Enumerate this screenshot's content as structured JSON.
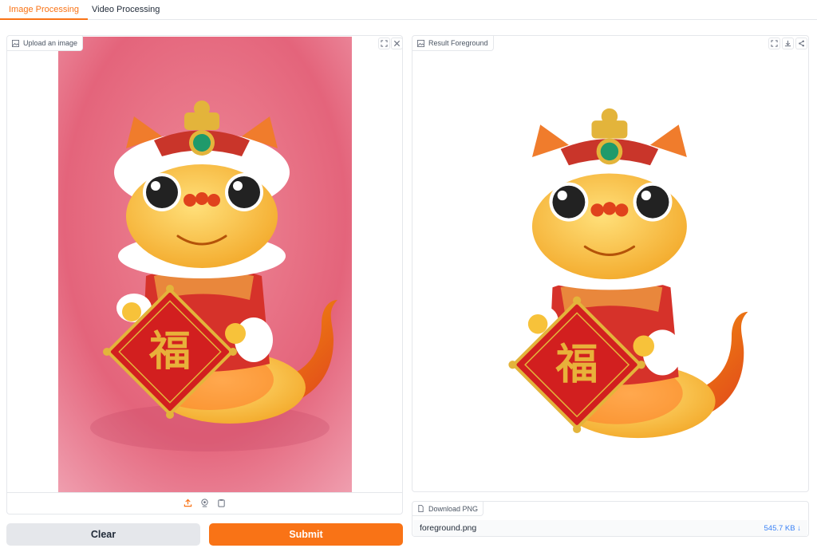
{
  "tabs": [
    {
      "label": "Image Processing",
      "active": true
    },
    {
      "label": "Video Processing",
      "active": false
    }
  ],
  "input_panel": {
    "label": "Upload an image",
    "label_icon": "image-icon",
    "tools": [
      "fullscreen-icon",
      "close-icon"
    ],
    "sources": [
      "upload-icon",
      "webcam-icon",
      "clipboard-icon"
    ]
  },
  "output_panel": {
    "label": "Result Foreground",
    "label_icon": "image-icon",
    "tools": [
      "fullscreen-icon",
      "download-icon",
      "share-icon"
    ]
  },
  "download": {
    "label": "Download PNG",
    "label_icon": "file-icon",
    "filename": "foreground.png",
    "size": "545.7 KB ↓"
  },
  "buttons": {
    "clear": "Clear",
    "submit": "Submit"
  },
  "colors": {
    "accent": "#f97316",
    "pink_background": "#e8737f",
    "link": "#3b82f6"
  }
}
